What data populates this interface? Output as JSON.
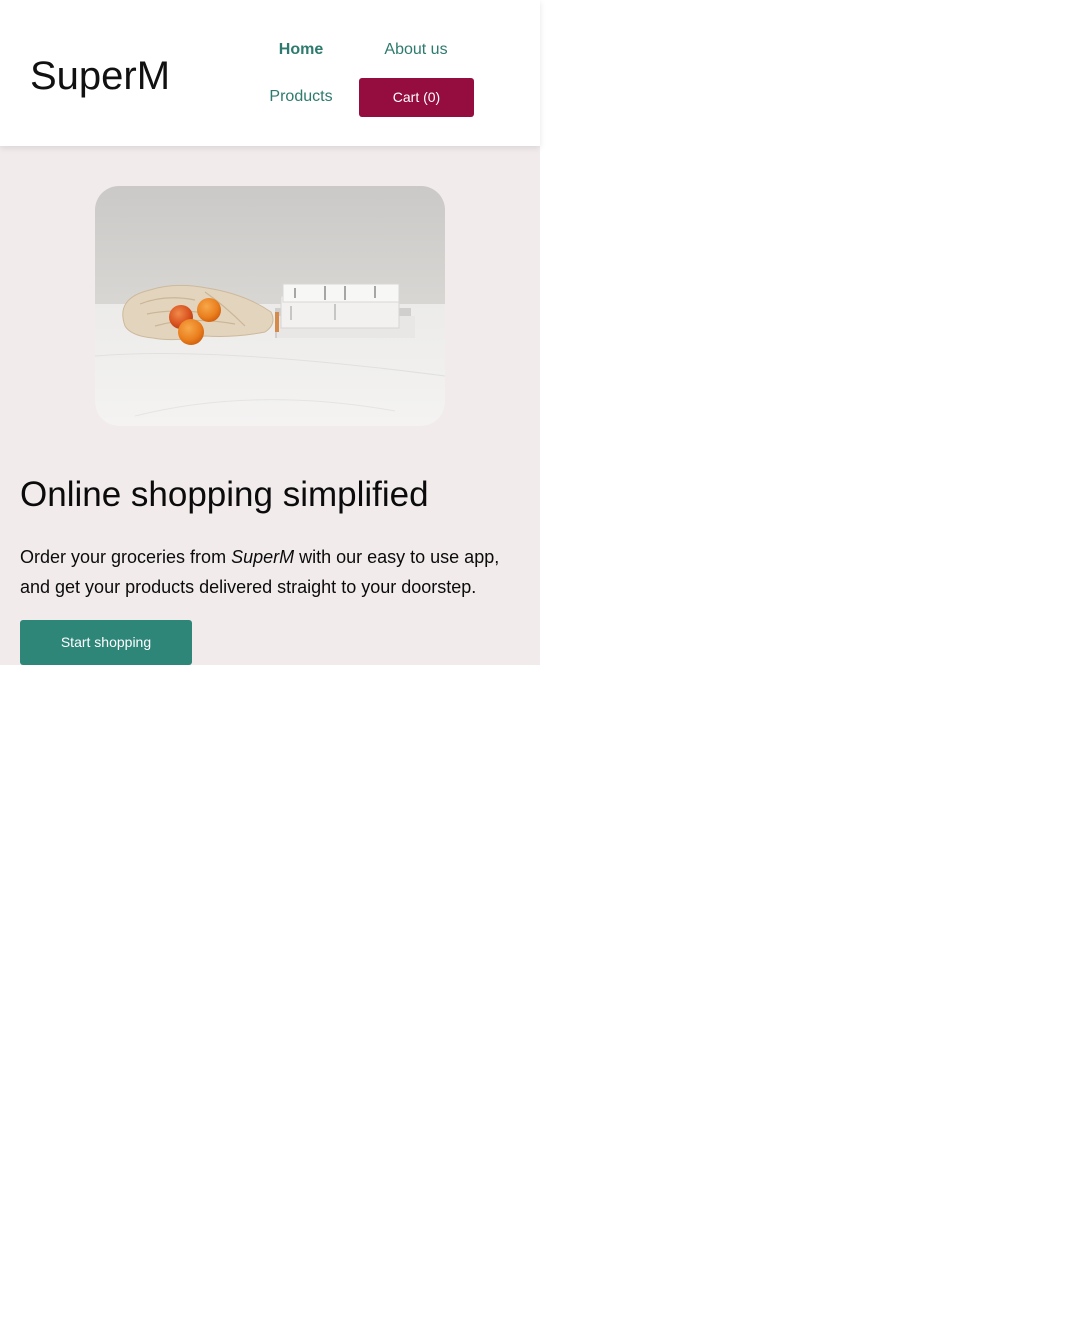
{
  "navbar": {
    "brand": "SuperM",
    "links": {
      "home": "Home",
      "about": "About us",
      "products": "Products"
    },
    "cart_label": "Cart (0)"
  },
  "hero": {
    "image_alt": "groceries-bag-with-oranges-and-books-photo",
    "title": "Online shopping simplified",
    "text_before": "Order your groceries from ",
    "text_brand": "SuperM",
    "text_after": " with our easy to use app, and get your products delivered straight to your doorstep.",
    "button_label": "Start shopping"
  },
  "colors": {
    "accent_green": "#2e8679",
    "link_green": "#2d7a6e",
    "cart_red": "#940d3e",
    "hero_background": "#f1ebec"
  }
}
